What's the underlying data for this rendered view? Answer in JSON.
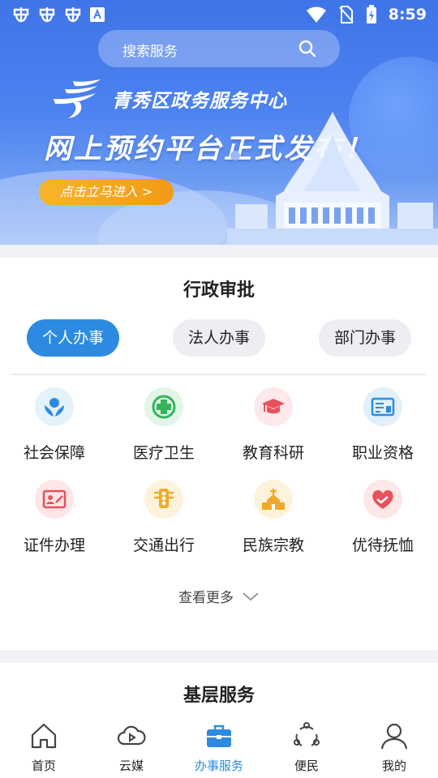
{
  "status_bar": {
    "time": "8:59"
  },
  "search": {
    "placeholder": "搜索服务"
  },
  "banner": {
    "org_name": "青秀区政务服务中心",
    "headline": "网上预约平台正式发布！",
    "cta": "点击立马进入 >"
  },
  "admin_section": {
    "title": "行政审批",
    "tabs": [
      {
        "label": "个人办事",
        "active": true
      },
      {
        "label": "法人办事",
        "active": false
      },
      {
        "label": "部门办事",
        "active": false
      }
    ],
    "items": [
      {
        "label": "社会保障",
        "icon": "social-security-icon",
        "color": "#e3f2fb"
      },
      {
        "label": "医疗卫生",
        "icon": "medical-cross-icon",
        "color": "#e2f5e6"
      },
      {
        "label": "教育科研",
        "icon": "graduation-cap-icon",
        "color": "#fde8ea"
      },
      {
        "label": "职业资格",
        "icon": "certificate-icon",
        "color": "#e1f0fb"
      },
      {
        "label": "证件办理",
        "icon": "id-card-icon",
        "color": "#fde6e6"
      },
      {
        "label": "交通出行",
        "icon": "traffic-light-icon",
        "color": "#fdf2dc"
      },
      {
        "label": "民族宗教",
        "icon": "church-icon",
        "color": "#fdf3dc"
      },
      {
        "label": "优待抚恤",
        "icon": "heart-hands-icon",
        "color": "#fde7e7"
      }
    ],
    "more_label": "查看更多"
  },
  "grassroots_section": {
    "title": "基层服务"
  },
  "bottom_nav": [
    {
      "label": "首页",
      "icon": "home-icon",
      "active": false
    },
    {
      "label": "云媒",
      "icon": "cloud-play-icon",
      "active": false
    },
    {
      "label": "办事服务",
      "icon": "briefcase-icon",
      "active": true
    },
    {
      "label": "便民",
      "icon": "share-circle-icon",
      "active": false
    },
    {
      "label": "我的",
      "icon": "user-icon",
      "active": false
    }
  ],
  "colors": {
    "accent": "#2c8be0",
    "banner": "#4c82f0",
    "cta": "#f4a622"
  }
}
